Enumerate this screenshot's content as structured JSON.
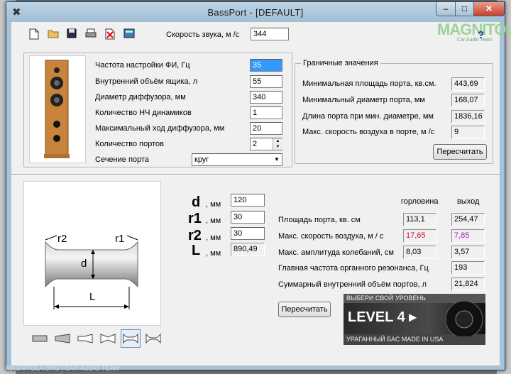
{
  "window": {
    "title": "BassPort - [DEFAULT]",
    "minimize": "–",
    "maximize": "□",
    "close": "✕"
  },
  "toolbar": {
    "sound_speed_label": "Скорость звука, м /с",
    "sound_speed_value": "344",
    "help": "?"
  },
  "params": [
    {
      "label": "Частота настройки ФИ, Гц",
      "value": "35"
    },
    {
      "label": "Внутренний объём ящика, л",
      "value": "55"
    },
    {
      "label": "Диаметр диффузора, мм",
      "value": "340"
    },
    {
      "label": "Количество НЧ динамиков",
      "value": "1"
    },
    {
      "label": "Максимальный ход диффузора, мм",
      "value": "20"
    },
    {
      "label": "Количество портов",
      "value": "2"
    },
    {
      "label": "Сечение порта",
      "value": "круг"
    }
  ],
  "limits": {
    "title": "Граничные значения",
    "rows": [
      {
        "label": "Минимальная площадь порта, кв.см.",
        "value": "443,69"
      },
      {
        "label": "Минимальный диаметр порта, мм",
        "value": "168,07"
      },
      {
        "label": "Длина порта при мин. диаметре, мм",
        "value": "1836,16"
      },
      {
        "label": "Макс. скорость воздуха в порте, м /с",
        "value": "9"
      }
    ],
    "button": "Пересчитать"
  },
  "diagram": {
    "r2": "r2",
    "r1": "r1",
    "d": "d",
    "L": "L"
  },
  "dims": [
    {
      "name": "d",
      "unit": ", мм",
      "value": "120"
    },
    {
      "name": "r1",
      "unit": ", мм",
      "value": "30"
    },
    {
      "name": "r2",
      "unit": ", мм",
      "value": "30"
    },
    {
      "name": "L",
      "unit": ", мм",
      "value": "890,49"
    }
  ],
  "results": {
    "col_throat": "горловина",
    "col_exit": "выход",
    "rows": [
      {
        "label": "Площадь порта, кв. см",
        "throat": "113,1",
        "exit": "254,47"
      },
      {
        "label": "Макс. скорость воздуха, м / с",
        "throat": "17,65",
        "exit": "7,85"
      },
      {
        "label": "Макс. амплитуда колебаний, см",
        "throat": "8,03",
        "exit": "3,57"
      },
      {
        "label": "Главная частота органного резонанса, Гц",
        "throat": "",
        "exit": "193"
      },
      {
        "label": "Суммарный внутренний объём портов, л",
        "throat": "",
        "exit": "21,824"
      }
    ],
    "button": "Пересчитать",
    "throat_speed_color": "#d01030",
    "exit_speed_color": "#b020c0"
  },
  "banner": {
    "top": "ВЫБЕРИ СВОЙ УРОВЕНЬ",
    "main": "LEVEL 4 ▸",
    "bottom": "УРАГАННЫЙ БАС MADE IN USA"
  },
  "watermark": "MAGNITOLA",
  "watermark_sub": "Car Audio Team",
  "status": "MAGNITOLA.ORG | CAR AUDIO TEAM"
}
